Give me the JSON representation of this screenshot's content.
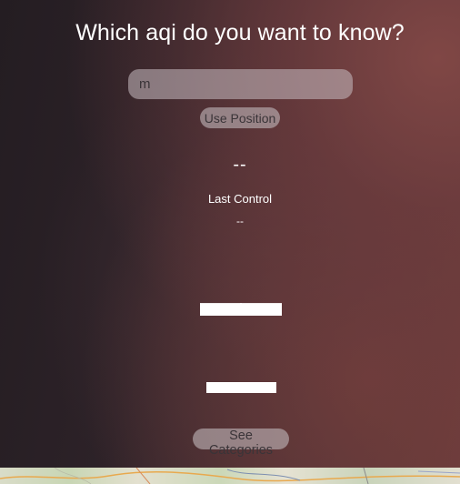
{
  "header": {
    "title": "Which aqi do you want to know?"
  },
  "search": {
    "value": "m",
    "placeholder": ""
  },
  "buttons": {
    "use_position": "Use Position",
    "see_categories": "See Categories"
  },
  "aqi": {
    "value": "--",
    "last_control_label": "Last Control",
    "last_control_value": "--",
    "level": "▬▬",
    "category": "▬▬"
  },
  "colors": {
    "text": "#ffffff",
    "control_bg": "#c8bec2"
  },
  "icons": {
    "map": "map-background"
  }
}
